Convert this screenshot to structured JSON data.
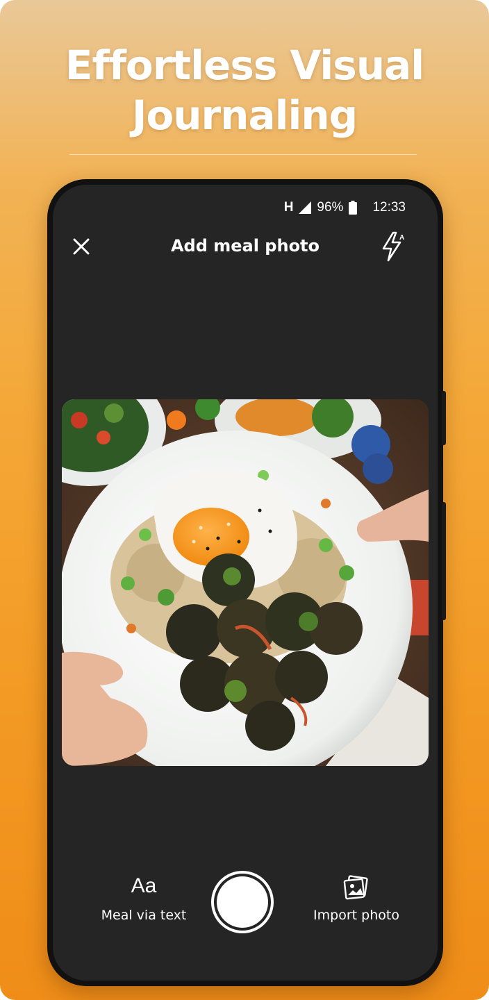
{
  "headline": {
    "line1": "Effortless Visual",
    "line2": "Journaling"
  },
  "status_bar": {
    "network": "H",
    "battery": "96%",
    "time": "12:33"
  },
  "camera": {
    "title": "Add meal photo",
    "close_icon": "close-icon",
    "flash_icon": "flash-auto-icon"
  },
  "bottom_bar": {
    "text_icon": "Aa",
    "text_label": "Meal via text",
    "import_label": "Import photo",
    "import_icon": "gallery-icon"
  },
  "colors": {
    "background_top": "#e9c898",
    "background_bottom": "#ef8d18",
    "screen": "#252525",
    "accent_text": "#ffffff"
  }
}
